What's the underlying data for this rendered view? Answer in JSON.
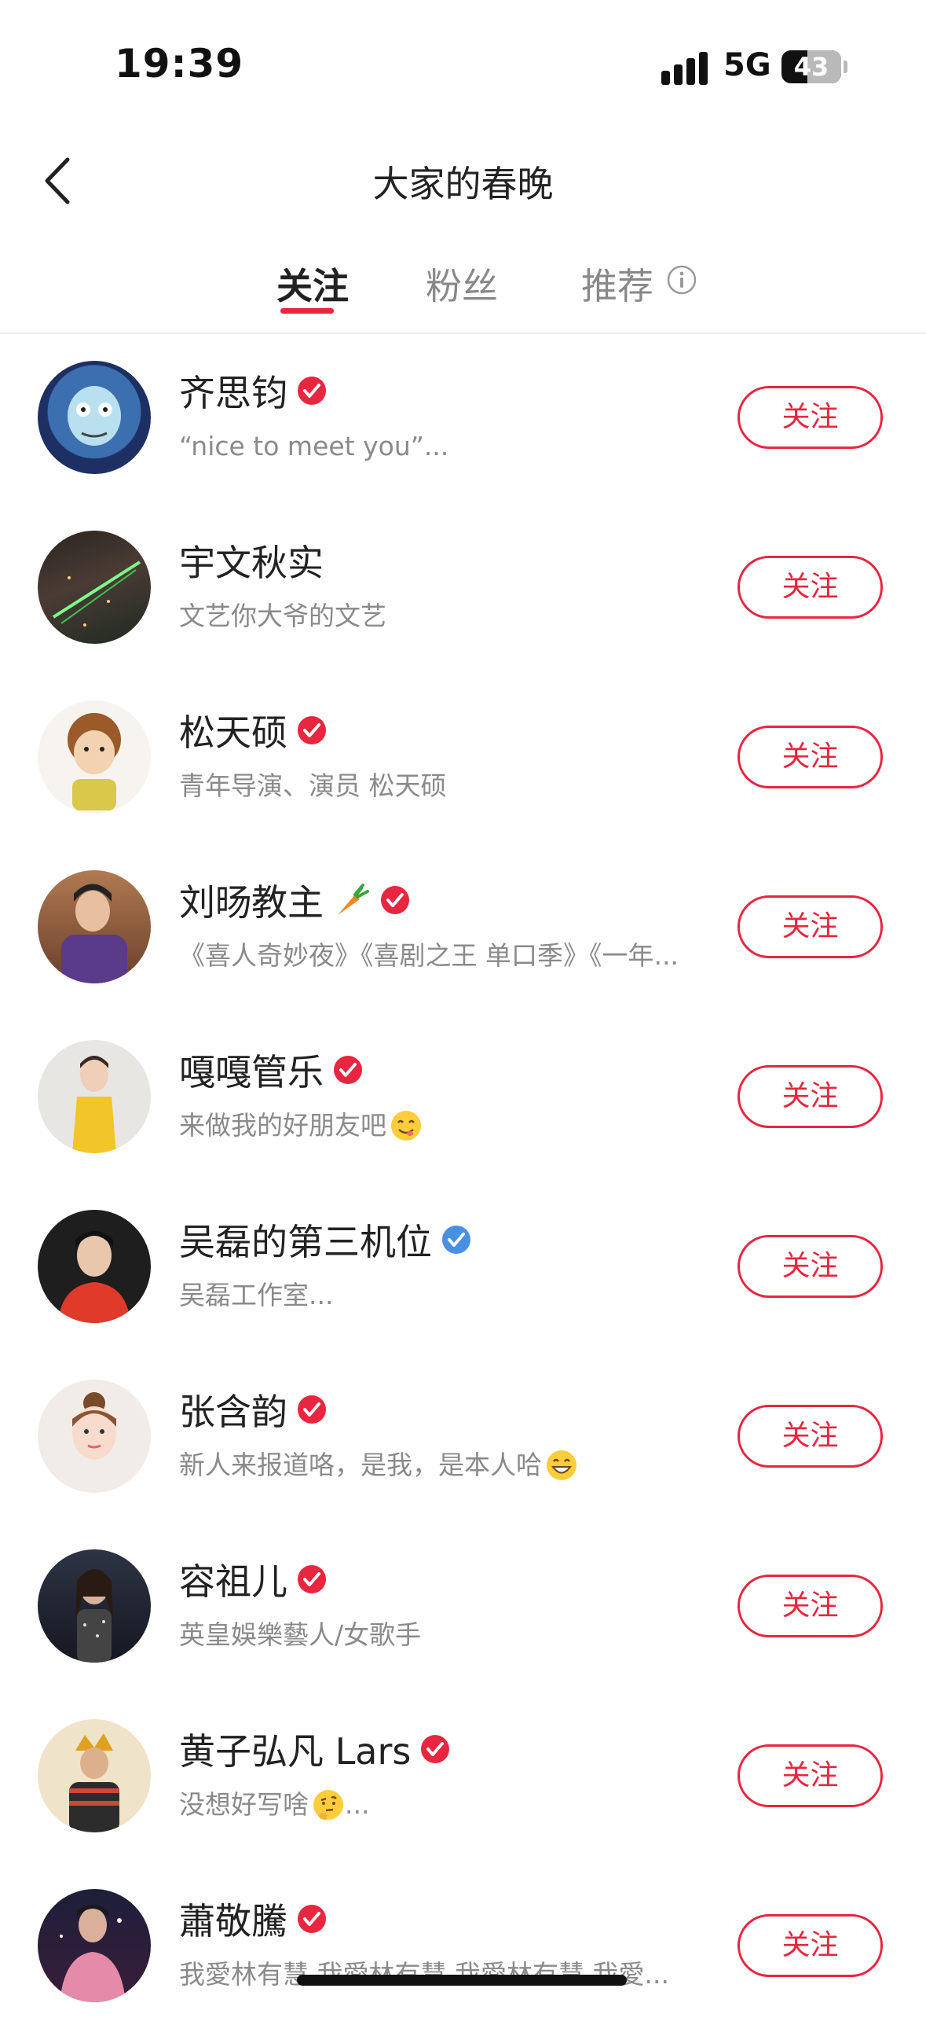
{
  "status": {
    "time": "19:39",
    "network": "5G",
    "battery": "43",
    "battery_level": 0.43
  },
  "nav": {
    "title": "大家的春晚",
    "back_icon": "chevron-left-icon"
  },
  "tabs": [
    {
      "label": "关注",
      "active": true
    },
    {
      "label": "粉丝",
      "active": false
    },
    {
      "label": "推荐",
      "active": false
    }
  ],
  "colors": {
    "accent": "#e8263f",
    "verified_red": "#e8263f",
    "verified_blue": "#4a90e2"
  },
  "users": [
    {
      "name": "齐思钧",
      "verified": "red",
      "bio": "“nice to meet you”...",
      "follow_label": "关注"
    },
    {
      "name": "宇文秋实",
      "verified": "none",
      "bio": "文艺你大爷的文艺",
      "follow_label": "关注"
    },
    {
      "name": "松天硕",
      "verified": "red",
      "bio": "青年导演、演员 松天硕",
      "follow_label": "关注"
    },
    {
      "name": "刘旸教主",
      "verified": "red",
      "name_emoji": "carrot",
      "bio": "《喜人奇妙夜》《喜剧之王 单口季》《一年...",
      "follow_label": "关注"
    },
    {
      "name": "嘎嘎管乐",
      "verified": "red",
      "bio": "来做我的好朋友吧",
      "bio_emoji": "yum",
      "follow_label": "关注"
    },
    {
      "name": "吴磊的第三机位",
      "verified": "blue",
      "bio": "吴磊工作室...",
      "follow_label": "关注"
    },
    {
      "name": "张含韵",
      "verified": "red",
      "bio": "新人来报道咯，是我，是本人哈",
      "bio_emoji": "grin",
      "follow_label": "关注"
    },
    {
      "name": "容祖儿",
      "verified": "red",
      "bio": "英皇娛樂藝人/女歌手",
      "follow_label": "关注"
    },
    {
      "name": "黄子弘凡 Lars",
      "verified": "red",
      "bio": "没想好写啥",
      "bio_emoji": "thinking",
      "bio_suffix": "...",
      "follow_label": "关注"
    },
    {
      "name": "蕭敬騰",
      "verified": "red",
      "bio": "我愛林有慧 我愛林有慧 我愛林有慧 我愛...",
      "follow_label": "关注"
    }
  ]
}
